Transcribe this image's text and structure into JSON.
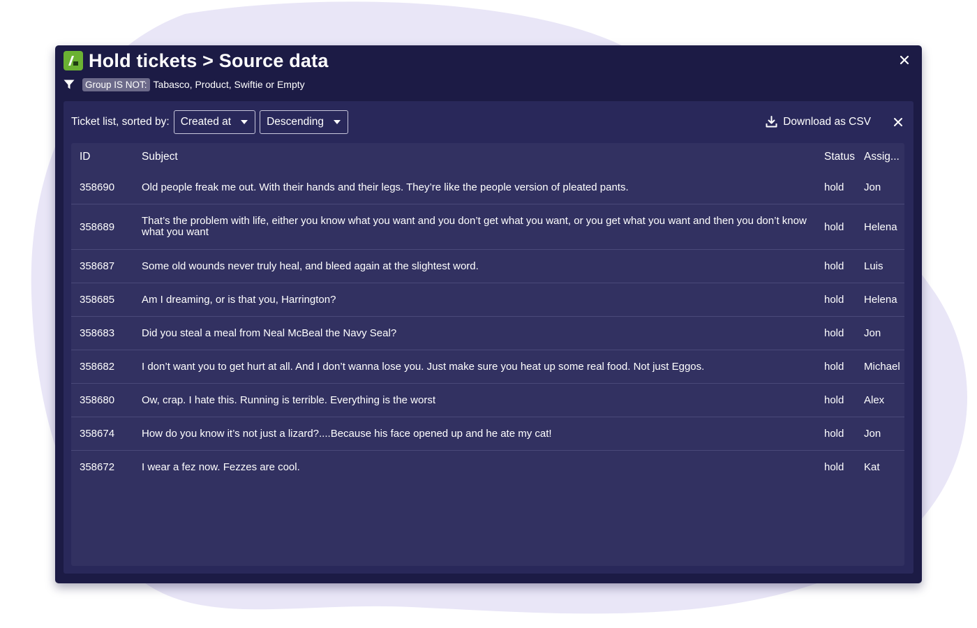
{
  "header": {
    "title": "Hold tickets > Source data"
  },
  "filter": {
    "badge": "Group IS NOT:",
    "value": "Tabasco, Product, Swiftie or Empty"
  },
  "toolbar": {
    "sort_label": "Ticket list, sorted by:",
    "sort_field": "Created at",
    "sort_order": "Descending",
    "download_label": "Download as CSV"
  },
  "table": {
    "columns": [
      "ID",
      "Subject",
      "Status",
      "Assig..."
    ],
    "rows": [
      {
        "id": "358690",
        "subject": "Old people freak me out. With their hands and their legs. They’re like the people version of pleated pants.",
        "status": "hold",
        "assignee": "Jon"
      },
      {
        "id": "358689",
        "subject": "That’s the problem with life, either you know what you want and you don’t get what you want, or you get what you want and then you don’t know what you want",
        "status": "hold",
        "assignee": "Helena"
      },
      {
        "id": "358687",
        "subject": "Some old wounds never truly heal, and bleed again at the slightest word.",
        "status": "hold",
        "assignee": "Luis"
      },
      {
        "id": "358685",
        "subject": "Am I dreaming, or is that you, Harrington?",
        "status": "hold",
        "assignee": "Helena"
      },
      {
        "id": "358683",
        "subject": "Did you steal a meal from Neal McBeal the Navy Seal?",
        "status": "hold",
        "assignee": "Jon"
      },
      {
        "id": "358682",
        "subject": "I don’t want you to get hurt at all. And I don’t wanna lose you. Just make sure you heat up some real food. Not just Eggos.",
        "status": "hold",
        "assignee": "Michael"
      },
      {
        "id": "358680",
        "subject": "Ow, crap. I hate this. Running is terrible. Everything is the worst",
        "status": "hold",
        "assignee": "Alex"
      },
      {
        "id": "358674",
        "subject": "How do you know it’s not just a lizard?....Because his face opened up and he ate my cat!",
        "status": "hold",
        "assignee": "Jon"
      },
      {
        "id": "358672",
        "subject": "I wear a fez now. Fezzes are cool.",
        "status": "hold",
        "assignee": "Kat"
      }
    ]
  },
  "icons": {
    "app": "app-logo-icon",
    "close": "close-icon",
    "filter": "filter-icon",
    "caret": "caret-down-icon",
    "download": "download-icon"
  },
  "colors": {
    "window_bg": "#1c1b45",
    "panel_bg": "#29285a",
    "table_bg": "#323161",
    "brand_green": "#6bb233",
    "backdrop_blob": "#e9e6f7"
  }
}
